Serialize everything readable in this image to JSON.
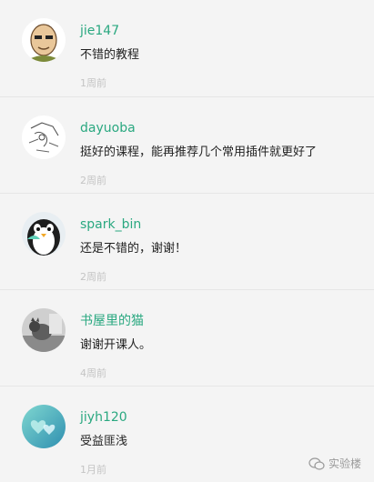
{
  "comments": [
    {
      "username": "jie147",
      "text": "不错的教程",
      "time": "1周前",
      "avatar_icon": "avatar-cartoon-bald-icon"
    },
    {
      "username": "dayuoba",
      "text": "挺好的课程，能再推荐几个常用插件就更好了",
      "time": "2周前",
      "avatar_icon": "avatar-sketch-icon"
    },
    {
      "username": "spark_bin",
      "text": "还是不错的，谢谢！",
      "time": "2周前",
      "avatar_icon": "avatar-penguin-icon"
    },
    {
      "username": "书屋里的猫",
      "text": "谢谢开课人。",
      "time": "4周前",
      "avatar_icon": "avatar-cat-photo-icon"
    },
    {
      "username": "jiyh120",
      "text": "受益匪浅",
      "time": "1月前",
      "avatar_icon": "avatar-hearts-icon"
    }
  ],
  "watermark": {
    "label": "实验楼",
    "icon": "wechat-icon"
  },
  "colors": {
    "username": "#2aa880",
    "text": "#222222",
    "time": "#c4c4c4",
    "background": "#f4f4f4"
  }
}
